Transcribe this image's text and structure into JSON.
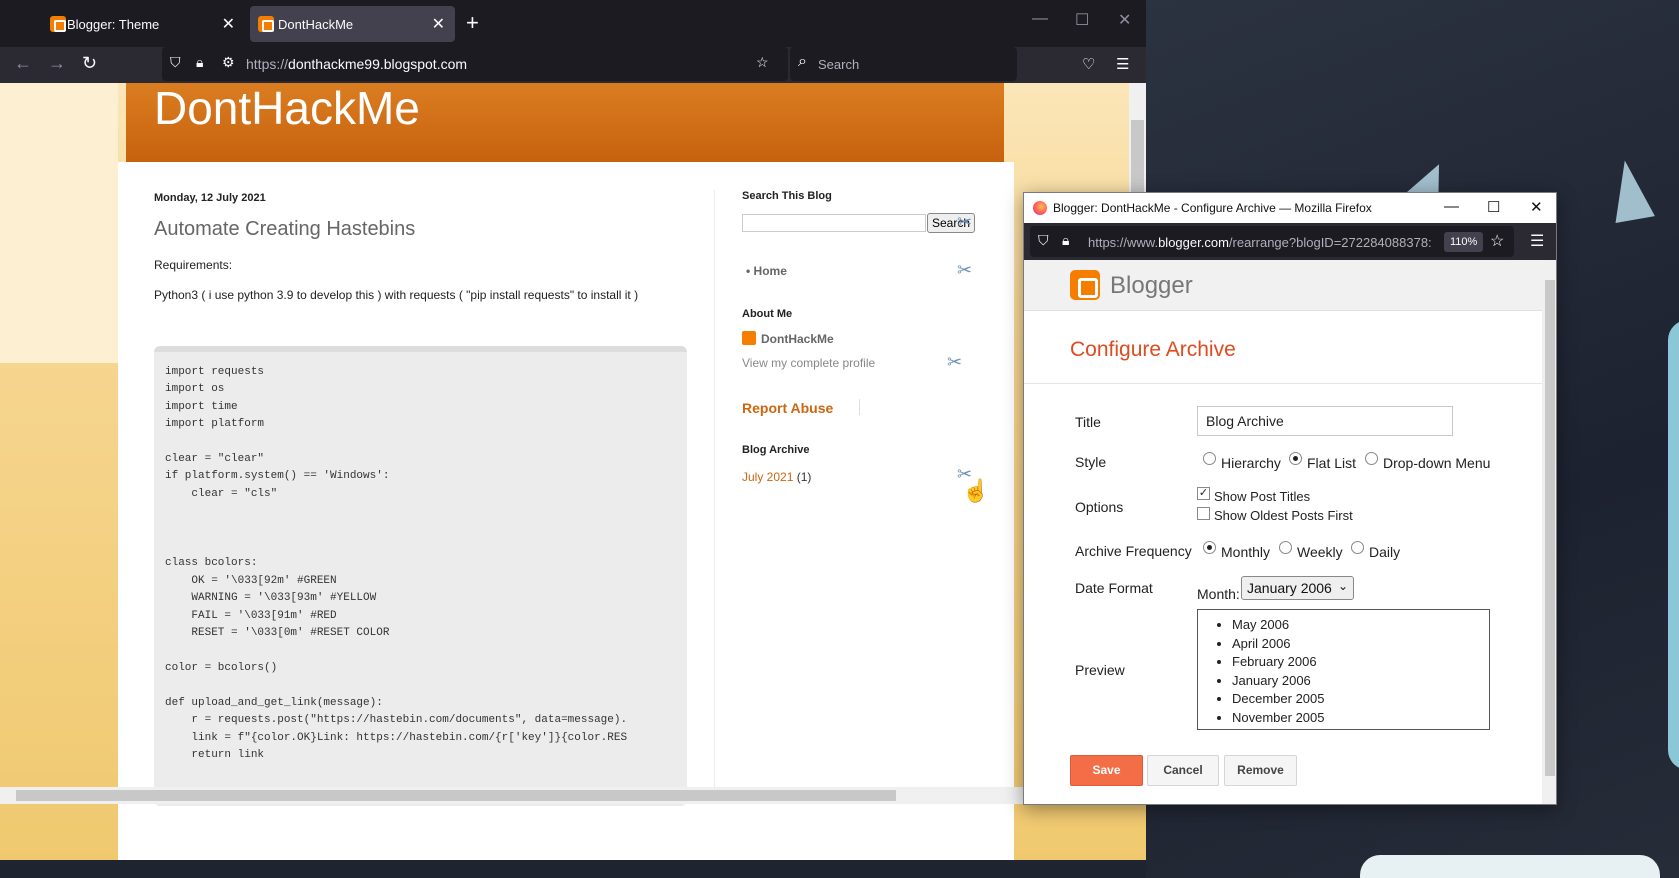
{
  "tabs": [
    {
      "label": "Blogger: Theme",
      "active": false
    },
    {
      "label": "DontHackMe",
      "active": true
    }
  ],
  "nav": {
    "url_scheme": "https://",
    "url_host": "donthackme99.blogspot.com",
    "search_placeholder": "Search"
  },
  "blog": {
    "header_title": "DontHackMe",
    "post_date": "Monday, 12 July 2021",
    "post_title": "Automate Creating Hastebins",
    "requirements_label": "Requirements:",
    "requirements_text": "Python3 ( i use python 3.9 to develop this ) with requests ( \"pip install requests\" to install it )",
    "code": "import requests\nimport os\nimport time\nimport platform\n\nclear = \"clear\"\nif platform.system() == 'Windows':\n    clear = \"cls\"\n\n\n\nclass bcolors:\n    OK = '\\033[92m' #GREEN\n    WARNING = '\\033[93m' #YELLOW\n    FAIL = '\\033[91m' #RED\n    RESET = '\\033[0m' #RESET COLOR\n\ncolor = bcolors()\n\ndef upload_and_get_link(message):\n    r = requests.post(\"https://hastebin.com/documents\", data=message).\n    link = f\"{color.OK}Link: https://hastebin.com/{r['key']}{color.RES\n    return link"
  },
  "sidebar": {
    "search_heading": "Search This Blog",
    "search_button": "Search",
    "home_link": "Home",
    "about_heading": "About Me",
    "about_name": "DontHackMe",
    "view_profile": "View my complete profile",
    "report_abuse": "Report Abuse",
    "archive_heading": "Blog Archive",
    "archive_month": "July 2021",
    "archive_count": "(1)"
  },
  "popup": {
    "window_title": "Blogger: DontHackMe - Configure Archive — Mozilla Firefox",
    "url_scheme": "https://www.",
    "url_host": "blogger.com",
    "url_rest": "/rearrange?blogID=272284088378:",
    "zoom": "110%",
    "brand": "Blogger",
    "heading": "Configure Archive",
    "title_label": "Title",
    "title_value": "Blog Archive",
    "style_label": "Style",
    "style_options": [
      "Hierarchy",
      "Flat List",
      "Drop-down Menu"
    ],
    "style_selected": "Flat List",
    "options_label": "Options",
    "option_show_titles": "Show Post Titles",
    "option_show_titles_checked": true,
    "option_oldest_first": "Show Oldest Posts First",
    "option_oldest_first_checked": false,
    "frequency_label": "Archive Frequency",
    "frequency_options": [
      "Monthly",
      "Weekly",
      "Daily"
    ],
    "frequency_selected": "Monthly",
    "date_format_label": "Date Format",
    "month_label": "Month:",
    "month_value": "January 2006",
    "preview_label": "Preview",
    "preview_items": [
      "May 2006",
      "April 2006",
      "February 2006",
      "January 2006",
      "December 2005",
      "November 2005"
    ],
    "save": "Save",
    "cancel": "Cancel",
    "remove": "Remove"
  },
  "colors": {
    "accent": "#dd4b1f",
    "save_button": "#f36e46",
    "header_orange": "#c7610e",
    "link_orange": "#cc6611"
  }
}
